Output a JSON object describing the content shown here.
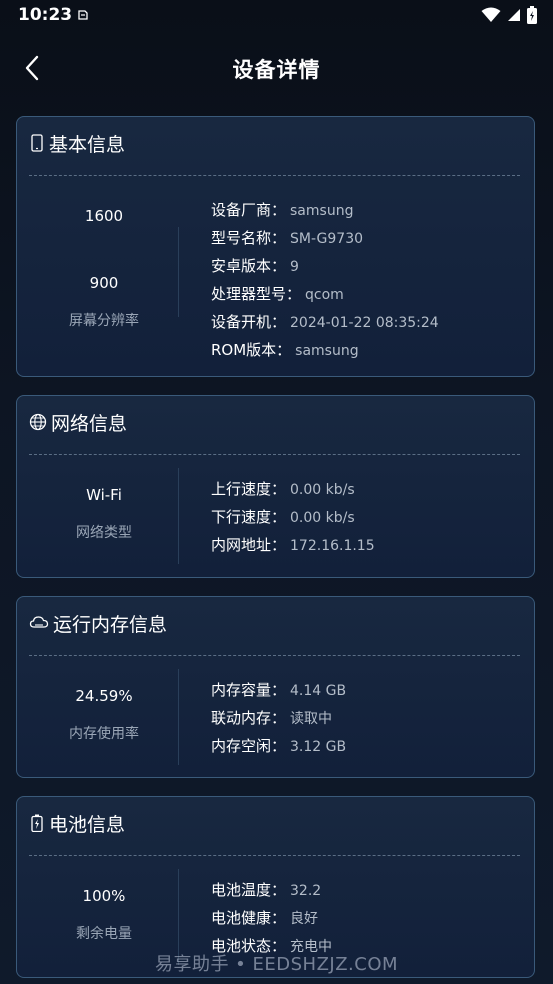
{
  "status": {
    "time": "10:23"
  },
  "nav": {
    "title": "设备详情"
  },
  "basic": {
    "title": "基本信息",
    "res_height": "1600",
    "res_width": "900",
    "res_label": "屏幕分辨率",
    "rows": [
      {
        "key": "设备厂商：",
        "val": "samsung"
      },
      {
        "key": "型号名称：",
        "val": "SM-G9730"
      },
      {
        "key": "安卓版本：",
        "val": "9"
      },
      {
        "key": "处理器型号：",
        "val": "qcom"
      },
      {
        "key": "设备开机：",
        "val": "2024-01-22 08:35:24"
      },
      {
        "key": "ROM版本：",
        "val": "samsung"
      }
    ]
  },
  "network": {
    "title": "网络信息",
    "type_value": "Wi-Fi",
    "type_label": "网络类型",
    "rows": [
      {
        "key": "上行速度：",
        "val": "0.00 kb/s"
      },
      {
        "key": "下行速度：",
        "val": "0.00 kb/s"
      },
      {
        "key": "内网地址：",
        "val": "172.16.1.15"
      }
    ]
  },
  "memory": {
    "title": "运行内存信息",
    "usage_value": "24.59%",
    "usage_label": "内存使用率",
    "rows": [
      {
        "key": "内存容量：",
        "val": "4.14 GB"
      },
      {
        "key": "联动内存：",
        "val": "读取中"
      },
      {
        "key": "内存空闲：",
        "val": "3.12 GB"
      }
    ]
  },
  "battery": {
    "title": "电池信息",
    "level_value": "100%",
    "level_label": "剩余电量",
    "rows": [
      {
        "key": "电池温度：",
        "val": "32.2"
      },
      {
        "key": "电池健康：",
        "val": "良好"
      },
      {
        "key": "电池状态：",
        "val": "充电中"
      }
    ]
  },
  "watermark": "易享助手 • EEDSHZJZ.COM"
}
